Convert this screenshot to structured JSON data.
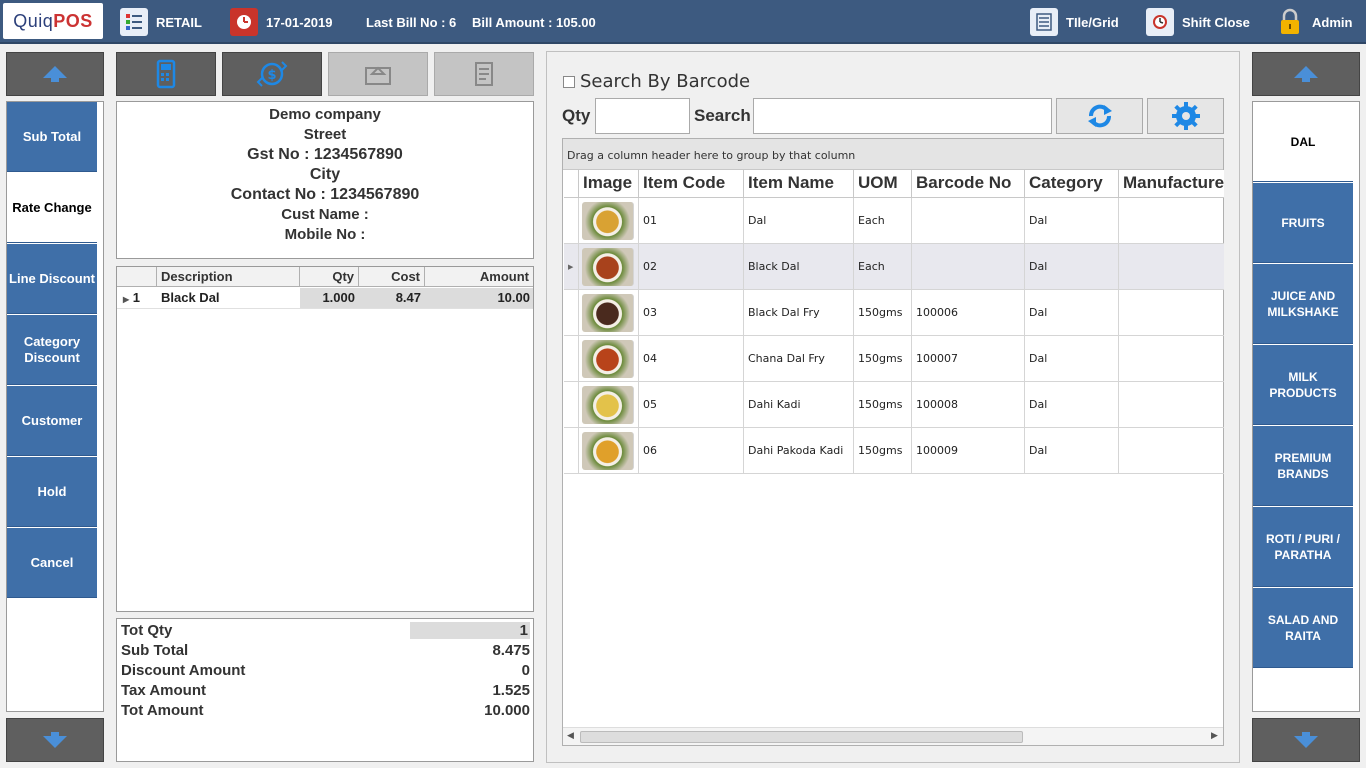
{
  "topbar": {
    "logo_left": "Quiq",
    "logo_right": "POS",
    "mode": "RETAIL",
    "date": "17-01-2019",
    "last_bill": "Last Bill No : 6",
    "bill_amount": "Bill Amount : 105.00",
    "tile_grid": "TIle/Grid",
    "shift_close": "Shift Close",
    "user": "Admin"
  },
  "left_actions": [
    "Sub Total",
    "Rate Change",
    "Line Discount",
    "Category Discount",
    "Customer",
    "Hold",
    "Cancel"
  ],
  "receipt": {
    "company": "Demo company",
    "street": "Street",
    "gst": "Gst No : 1234567890",
    "city": "City",
    "contact": "Contact No : 1234567890",
    "cust_name": "Cust Name :",
    "mobile": "Mobile No :"
  },
  "bill_grid": {
    "headers": {
      "desc": "Description",
      "qty": "Qty",
      "cost": "Cost",
      "amount": "Amount"
    },
    "rows": [
      {
        "no": "1",
        "desc": "Black Dal",
        "qty": "1.000",
        "cost": "8.47",
        "amount": "10.00"
      }
    ]
  },
  "totals": {
    "tot_qty_label": "Tot Qty",
    "tot_qty": "1",
    "sub_total_label": "Sub Total",
    "sub_total": "8.475",
    "discount_label": "Discount Amount",
    "discount": "0",
    "tax_label": "Tax Amount",
    "tax": "1.525",
    "tot_amount_label": "Tot Amount",
    "tot_amount": "10.000"
  },
  "search": {
    "barcode_label": "Search By Barcode",
    "qty_label": "Qty",
    "search_label": "Search",
    "group_hint": "Drag a column header here to group by that column"
  },
  "items_grid": {
    "headers": {
      "image": "Image",
      "code": "Item Code",
      "name": "Item Name",
      "uom": "UOM",
      "barcode": "Barcode No",
      "category": "Category",
      "manufacturer": "Manufacture"
    },
    "rows": [
      {
        "code": "01",
        "name": "Dal",
        "uom": "Each",
        "barcode": "",
        "category": "Dal",
        "food_color": "#d9a233"
      },
      {
        "code": "02",
        "name": "Black Dal",
        "uom": "Each",
        "barcode": "",
        "category": "Dal",
        "food_color": "#a8421c"
      },
      {
        "code": "03",
        "name": "Black Dal Fry",
        "uom": "150gms",
        "barcode": "100006",
        "category": "Dal",
        "food_color": "#4a2a1e"
      },
      {
        "code": "04",
        "name": "Chana Dal Fry",
        "uom": "150gms",
        "barcode": "100007",
        "category": "Dal",
        "food_color": "#b8431a"
      },
      {
        "code": "05",
        "name": "Dahi Kadi",
        "uom": "150gms",
        "barcode": "100008",
        "category": "Dal",
        "food_color": "#e3c24a"
      },
      {
        "code": "06",
        "name": "Dahi Pakoda Kadi",
        "uom": "150gms",
        "barcode": "100009",
        "category": "Dal",
        "food_color": "#e0a02a"
      }
    ]
  },
  "categories": [
    "DAL",
    "FRUITS",
    "JUICE AND MILKSHAKE",
    "MILK PRODUCTS",
    "PREMIUM BRANDS",
    "ROTI / PURI / PARATHA",
    "SALAD AND RAITA"
  ],
  "colors": {
    "accent": "#3f6fa8",
    "topbar": "#3d5a80",
    "dark_button": "#5f5f5f",
    "icon_blue": "#1e88e5"
  }
}
